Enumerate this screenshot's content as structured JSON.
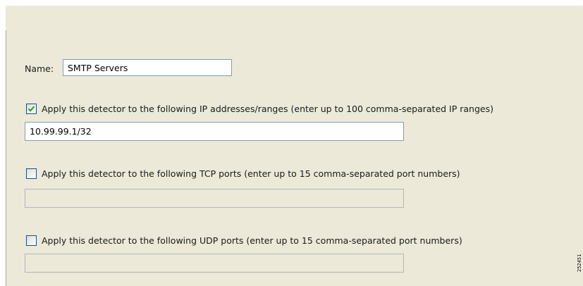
{
  "form": {
    "name_label": "Name:",
    "name_value": "SMTP Servers",
    "ip_option": {
      "checked": true,
      "label": "Apply this detector to the following IP addresses/ranges (enter up to 100 comma-separated IP ranges)",
      "value": "10.99.99.1/32"
    },
    "tcp_option": {
      "checked": false,
      "label": "Apply this detector to the following TCP ports (enter up to 15 comma-separated port numbers)",
      "value": ""
    },
    "udp_option": {
      "checked": false,
      "label": "Apply this detector to the following UDP ports (enter up to 15 comma-separated port numbers)",
      "value": ""
    }
  },
  "figure_id": "252451",
  "colors": {
    "panel_bg": "#ece9d8",
    "field_border": "#7f9db9",
    "checkmark": "#21a121"
  }
}
